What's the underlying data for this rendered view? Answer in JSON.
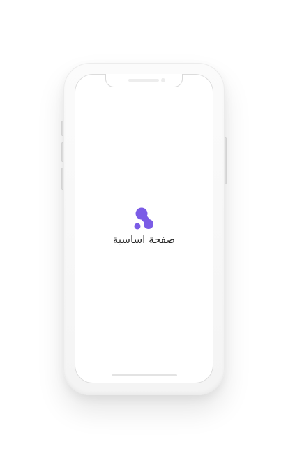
{
  "app": {
    "title": "صفحة اساسية",
    "logo_icon": "app-logo-icon",
    "brand_color": "#7b5ce6"
  },
  "device": {
    "body_color": "#f6f6f6",
    "screen_color": "#ffffff"
  }
}
